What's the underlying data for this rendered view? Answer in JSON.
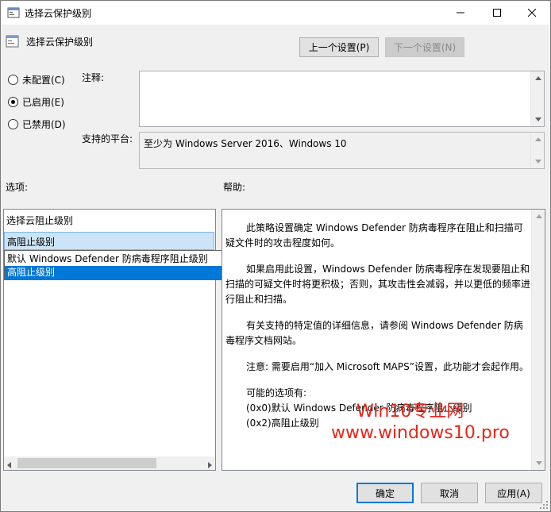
{
  "window": {
    "title": "选择云保护级别",
    "minimize_icon": "minimize-icon",
    "maximize_icon": "maximize-icon",
    "close_icon": "close-icon"
  },
  "header": {
    "policy_title": "选择云保护级别",
    "prev_button": "上一个设置(P)",
    "next_button": "下一个设置(N)"
  },
  "state": {
    "options": [
      {
        "label": "未配置(C)",
        "selected": false
      },
      {
        "label": "已启用(E)",
        "selected": true
      },
      {
        "label": "已禁用(D)",
        "selected": false
      }
    ]
  },
  "comment": {
    "label": "注释:",
    "value": ""
  },
  "platform": {
    "label": "支持的平台:",
    "value": "至少为 Windows Server 2016、Windows 10"
  },
  "options_section": {
    "label": "选项:",
    "field_label": "选择云阻止级别",
    "selected_value": "高阻止级别",
    "dropdown_options": [
      "默认 Windows Defender 防病毒程序阻止级别",
      "高阻止级别"
    ],
    "highlighted_index": 1
  },
  "help_section": {
    "label": "帮助:",
    "paragraphs": [
      "此策略设置确定 Windows Defender 防病毒程序在阻止和扫描可疑文件时的攻击程度如何。",
      "如果启用此设置，Windows Defender 防病毒程序在发现要阻止和扫描的可疑文件时将更积极；否则，其攻击性会减弱，并以更低的频率进行阻止和扫描。",
      "有关支持的特定值的详细信息，请参阅 Windows Defender 防病毒程序文档网站。",
      "注意: 需要启用“加入 Microsoft MAPS”设置，此功能才会起作用。"
    ],
    "options_intro": "可能的选项有:",
    "option_lines": [
      "(0x0)默认 Windows Defender 防病毒程序阻止级别",
      "(0x2)高阻止级别"
    ]
  },
  "watermark": {
    "line1": "Win10专业网",
    "line2": "www.windows10.pro",
    "color": "#e6261a"
  },
  "footer": {
    "ok": "确定",
    "cancel": "取消",
    "apply": "应用(A)"
  },
  "colors": {
    "accent": "#0078d7",
    "selection_bg": "#cce4f7"
  }
}
